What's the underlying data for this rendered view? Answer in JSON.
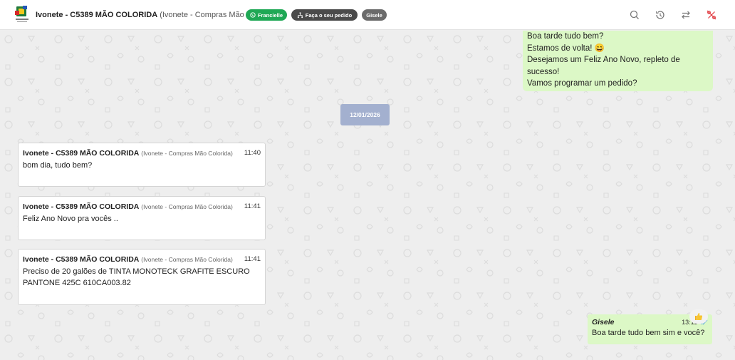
{
  "header": {
    "contact_name": "Ivonete - C5389 MÃO COLORIDA",
    "contact_sub": "(Ivonete - Compras Mão Colorida)",
    "pill_agent": "Francielle",
    "pill_order": "Faça o seu pedido",
    "pill_user": "Gisele",
    "icons": [
      "search-icon",
      "history-icon",
      "transfer-icon",
      "percent-off-icon"
    ]
  },
  "messages": {
    "outgoing_top": {
      "lines": [
        "Boa tarde tudo bem?",
        "Estamos de volta! 😄",
        "Desejamos um Feliz Ano Novo, repleto de sucesso!",
        "Vamos programar um pedido?"
      ]
    },
    "date_separator": "12/01/2026",
    "incoming": [
      {
        "name": "Ivonete - C5389 MÃO COLORIDA",
        "sub": "(Ivonete - Compras Mão Colorida)",
        "time": "11:40",
        "text": "bom dia, tudo bem?"
      },
      {
        "name": "Ivonete - C5389 MÃO COLORIDA",
        "sub": "(Ivonete - Compras Mão Colorida)",
        "time": "11:41",
        "text": "Feliz Ano Novo pra vocês .."
      },
      {
        "name": "Ivonete - C5389 MÃO COLORIDA",
        "sub": "(Ivonete - Compras Mão Colorida)",
        "time": "11:41",
        "text": "Preciso de 20 galões de TINTA MONOTECK GRAFITE ESCURO PANTONE 425C 610CA003.82"
      }
    ],
    "outgoing_bottom": {
      "sender": "Gisele",
      "time": "13:11",
      "text": "Boa tarde tudo bem sim e você?",
      "status": "read-double-check"
    }
  },
  "colors": {
    "outgoing_bubble": "#dcf8c6",
    "date_chip": "#a3b0cf",
    "pill_green": "#1fa855"
  }
}
